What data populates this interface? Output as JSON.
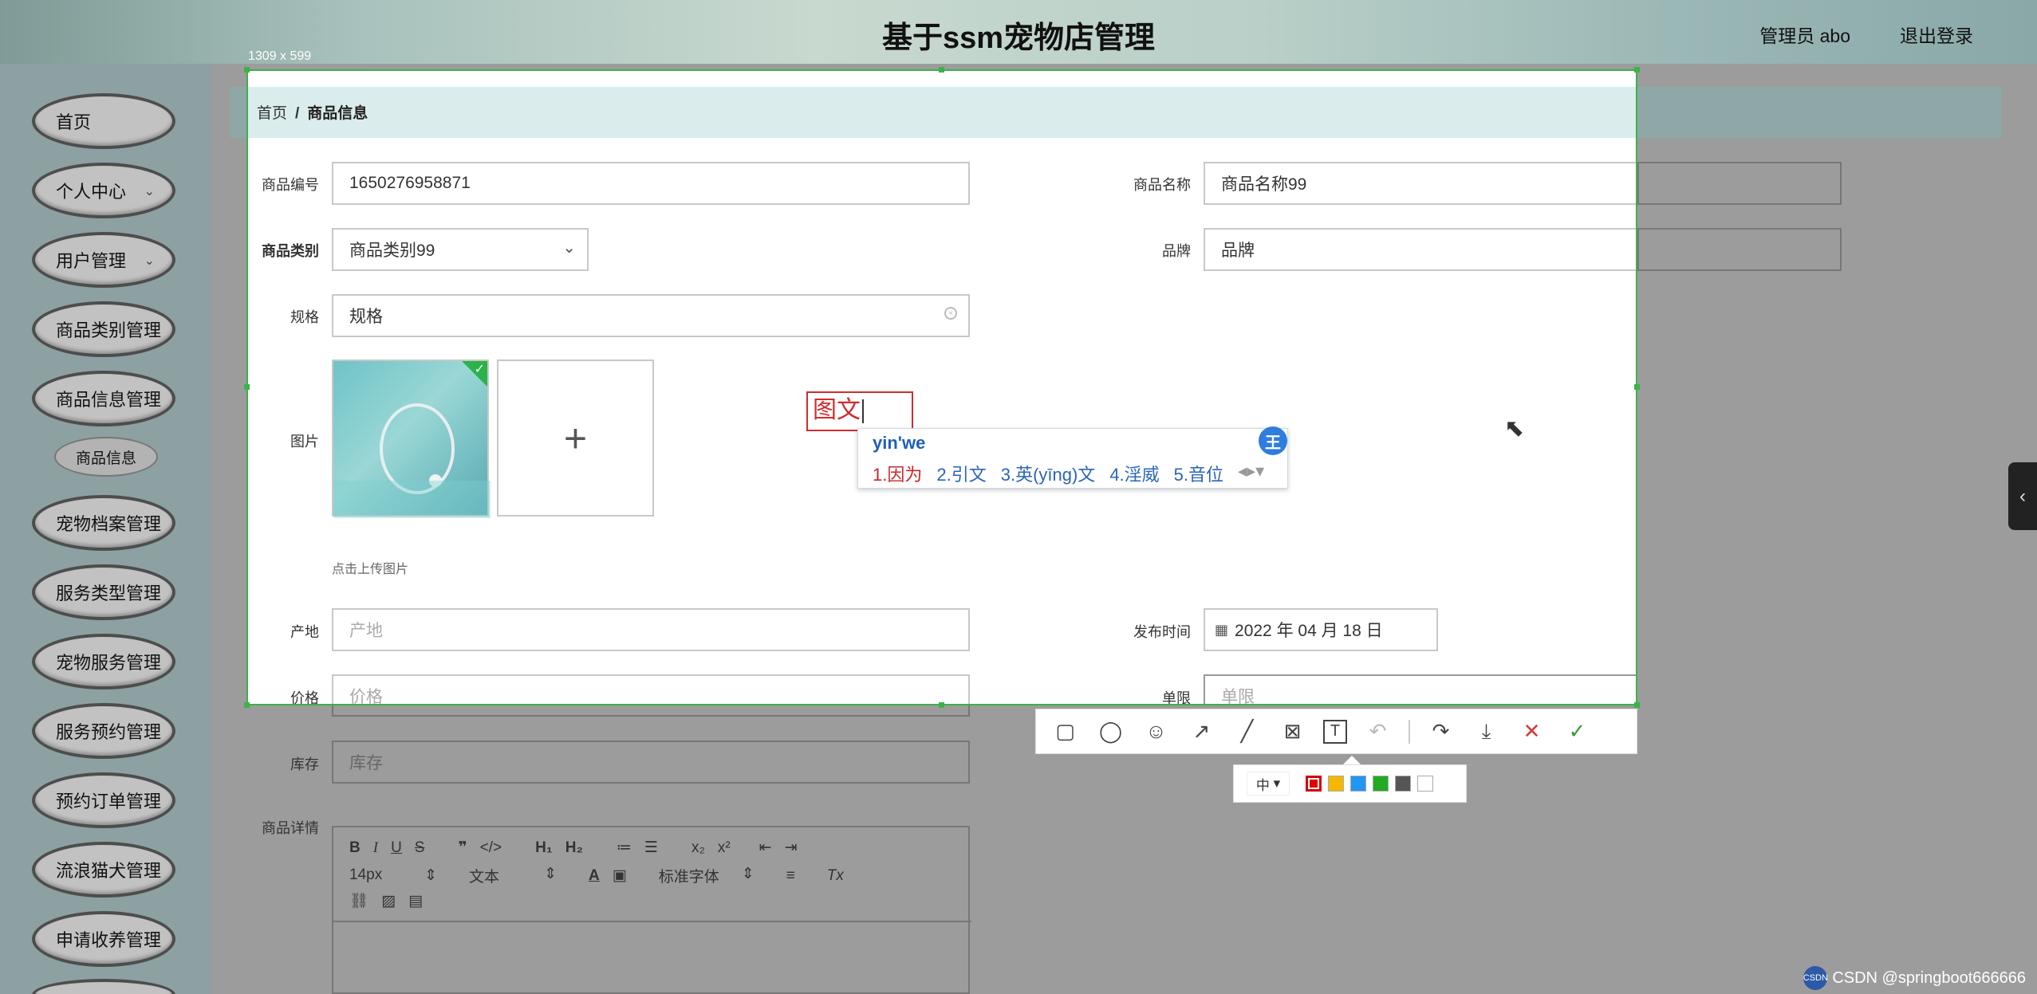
{
  "header": {
    "title": "基于ssm宠物店管理",
    "user": "管理员 abo",
    "logout": "退出登录"
  },
  "selection_size": "1309 x 599",
  "sidebar": {
    "items": [
      {
        "label": "首页"
      },
      {
        "label": "个人中心"
      },
      {
        "label": "用户管理"
      },
      {
        "label": "商品类别管理"
      },
      {
        "label": "商品信息管理"
      },
      {
        "label": "宠物档案管理"
      },
      {
        "label": "服务类型管理"
      },
      {
        "label": "宠物服务管理"
      },
      {
        "label": "服务预约管理"
      },
      {
        "label": "预约订单管理"
      },
      {
        "label": "流浪猫犬管理"
      },
      {
        "label": "申请收养管理"
      }
    ],
    "sub_item": "商品信息"
  },
  "breadcrumb": {
    "home": "首页",
    "sep": "/",
    "current": "商品信息"
  },
  "form": {
    "product_no": {
      "label": "商品编号",
      "value": "1650276958871"
    },
    "product_name": {
      "label": "商品名称",
      "value": "商品名称99"
    },
    "category": {
      "label": "商品类别",
      "value": "商品类别99"
    },
    "brand": {
      "label": "品牌",
      "value": "品牌"
    },
    "spec": {
      "label": "规格",
      "value": "规格"
    },
    "image": {
      "label": "图片",
      "hint": "点击上传图片"
    },
    "origin": {
      "label": "产地",
      "placeholder": "产地"
    },
    "publish_time": {
      "label": "发布时间",
      "value": "2022 年 04 月 18 日"
    },
    "price": {
      "label": "价格",
      "placeholder": "价格"
    },
    "limit": {
      "label": "单限",
      "placeholder": "单限"
    },
    "stock": {
      "label": "库存",
      "placeholder": "库存"
    },
    "detail": {
      "label": "商品详情"
    }
  },
  "annotation": {
    "text": "图文"
  },
  "ime": {
    "pinyin": "yin'we",
    "badge": "王",
    "candidates": [
      "1.因为",
      "2.引文",
      "3.英(yīng)文",
      "4.淫威",
      "5.音位"
    ]
  },
  "editor": {
    "font_size": "14px",
    "text_style": "文本",
    "font_family": "标准字体"
  },
  "color_picker": {
    "size": "中",
    "colors": [
      "#e00000",
      "#f5b800",
      "#2196f3",
      "#22aa22",
      "#555555",
      "#ffffff"
    ]
  },
  "watermark": {
    "text": "CSDN @springboot666666",
    "badge": "CSDN"
  }
}
